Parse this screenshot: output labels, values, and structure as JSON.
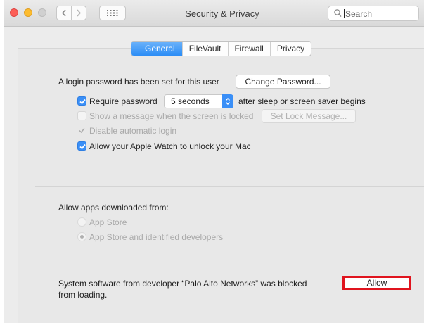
{
  "window": {
    "title": "Security & Privacy"
  },
  "search": {
    "placeholder": "Search",
    "icon": "search-icon"
  },
  "tabs": [
    {
      "label": "General",
      "active": true
    },
    {
      "label": "FileVault",
      "active": false
    },
    {
      "label": "Firewall",
      "active": false
    },
    {
      "label": "Privacy",
      "active": false
    }
  ],
  "general": {
    "login_text": "A login password has been set for this user",
    "change_password_label": "Change Password...",
    "require_password": {
      "label": "Require password",
      "checked": true
    },
    "require_delay": "5 seconds",
    "require_suffix": "after sleep or screen saver begins",
    "show_message": {
      "label": "Show a message when the screen is locked",
      "checked": false,
      "enabled": false
    },
    "set_lock_message_label": "Set Lock Message...",
    "disable_auto_login": {
      "label": "Disable automatic login",
      "checked": true,
      "enabled": false
    },
    "apple_watch": {
      "label": "Allow your Apple Watch to unlock your Mac",
      "checked": true
    }
  },
  "downloads": {
    "heading": "Allow apps downloaded from:",
    "options": [
      {
        "label": "App Store",
        "selected": false
      },
      {
        "label": "App Store and identified developers",
        "selected": true
      }
    ]
  },
  "blocked": {
    "line1": "System software from developer “Palo Alto Networks” was blocked",
    "line2": "from loading.",
    "allow_label": "Allow",
    "highlight_color": "#e0141e"
  },
  "colors": {
    "accent": "#3a8ff7"
  }
}
